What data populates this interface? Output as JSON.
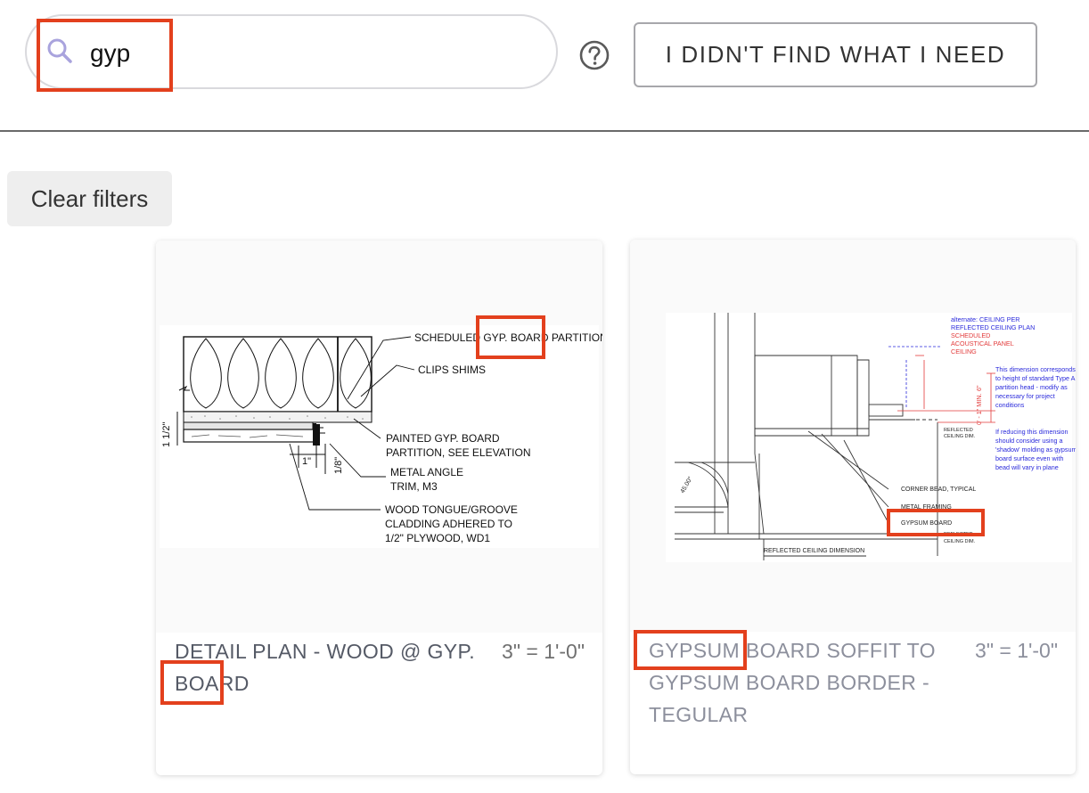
{
  "search": {
    "value": "gyp",
    "icon": "search-icon"
  },
  "help": {
    "icon": "question-circle-icon"
  },
  "not_found_button": {
    "label": "I DIDN'T FIND WHAT I NEED"
  },
  "filters": {
    "clear_label": "Clear filters"
  },
  "results": [
    {
      "title": "DETAIL PLAN - WOOD @ GYP. BOARD",
      "scale": "3\" = 1'-0\"",
      "drawing_labels": {
        "partition": "SCHEDULED GYP. BOARD PARTITION",
        "clips": "CLIPS SHIMS",
        "painted_line1": "PAINTED GYP. BOARD",
        "painted_line2": "PARTITION, SEE ELEVATION",
        "angle_line1": "METAL ANGLE",
        "angle_line2": "TRIM, M3",
        "wood_line1": "WOOD TONGUE/GROOVE",
        "wood_line2": "CLADDING ADHERED TO",
        "wood_line3": "1/2\" PLYWOOD,  WD1",
        "dim_vertical": "1 1/2\"",
        "dim_one": "1\"",
        "dim_eighth": "1/8\""
      }
    },
    {
      "title": "GYPSUM BOARD SOFFIT TO GYPSUM BOARD BORDER - TEGULAR",
      "scale": "3\" = 1'-0\"",
      "drawing_labels": {
        "alt_line1": "alternate: CEILING PER",
        "alt_line2": "REFLECTED CEILING PLAN",
        "sched_line1": "SCHEDULED",
        "sched_line2": "ACOUSTICAL PANEL",
        "sched_line3": "CEILING",
        "note1_line1": "This dimension corresponds",
        "note1_line2": "to height of standard Type A",
        "note1_line3": "partition head - modify as",
        "note1_line4": "necessary for project",
        "note1_line5": "conditions",
        "note2_line1": "If reducing this dimension",
        "note2_line2": "should consider using a",
        "note2_line3": "'shadow' molding as gypsum",
        "note2_line4": "board surface even with",
        "note2_line5": "bead will vary in plane",
        "corner_bead": "CORNER BEAD, TYPICAL",
        "metal_framing": "METAL FRAMING",
        "gypsum_board": "GYPSUM BOARD",
        "reflected_dim": "REFLECTED CEILING DIMENSION",
        "ceiling_dim_a1": "REFLECTED",
        "ceiling_dim_a2": "CEILING DIM.",
        "ceiling_dim_b1": "REFLECTED",
        "ceiling_dim_b2": "CEILING DIM.",
        "angle": "45.00°",
        "dim_red": "0' - 1\" MIN.",
        "dim_red_top": "6\""
      }
    }
  ],
  "colors": {
    "highlight": "#e3401d",
    "search_icon": "#a9a3dd",
    "drawing_note_blue": "#2a2adb",
    "drawing_note_red": "#e23a3a"
  }
}
